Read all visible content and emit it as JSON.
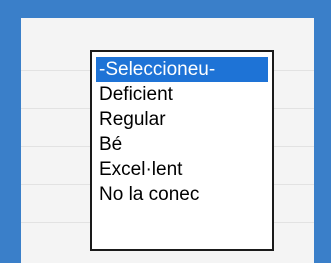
{
  "colors": {
    "frame_border": "#3a7fc9",
    "selected_bg": "#1e73d6",
    "selected_fg": "#ffffff"
  },
  "dropdown": {
    "options": [
      {
        "label": "-Seleccioneu-",
        "selected": true
      },
      {
        "label": "Deficient",
        "selected": false
      },
      {
        "label": "Regular",
        "selected": false
      },
      {
        "label": "Bé",
        "selected": false
      },
      {
        "label": "Excel·lent",
        "selected": false
      },
      {
        "label": "No la conec",
        "selected": false
      }
    ]
  }
}
